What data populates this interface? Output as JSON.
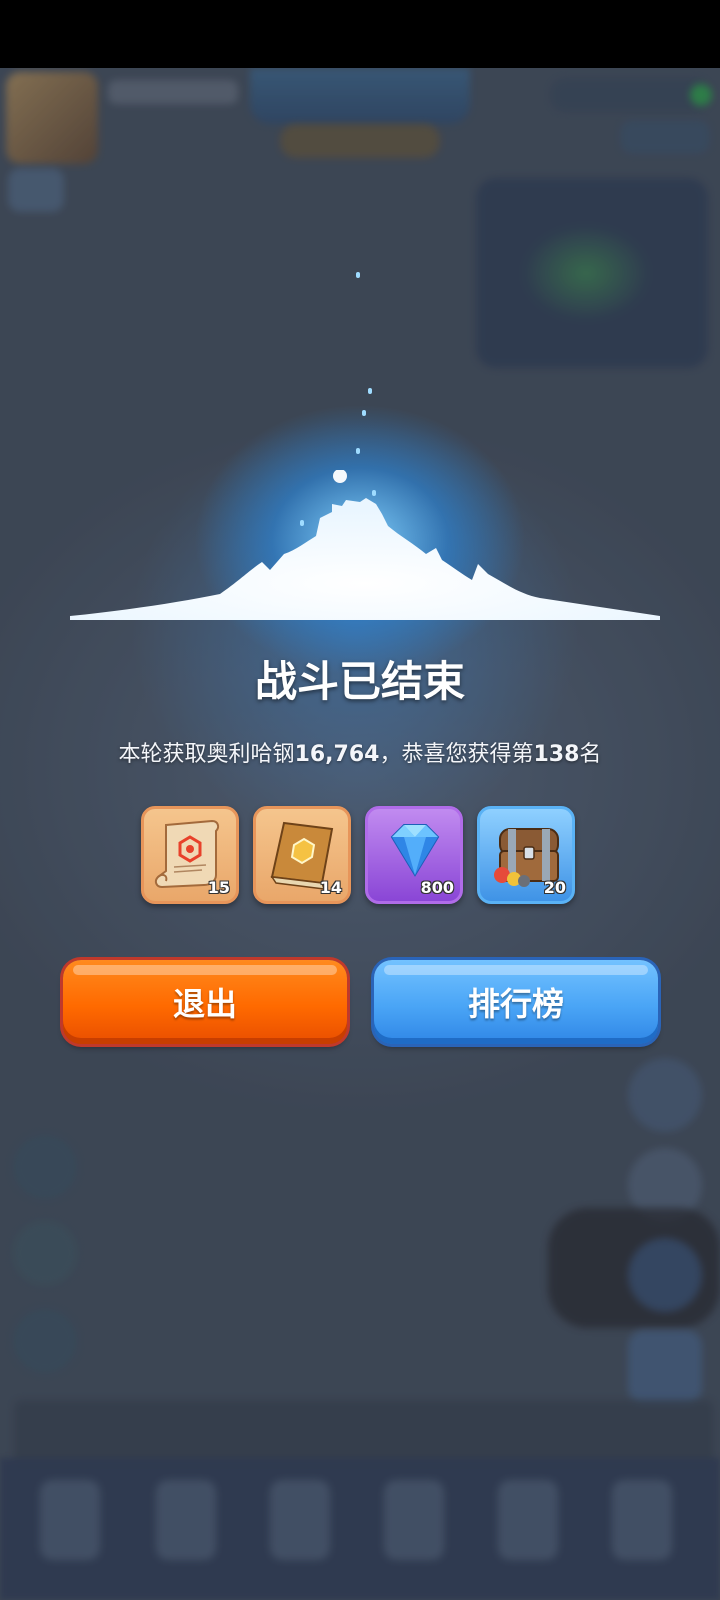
{
  "dialog": {
    "title": "战斗已结束",
    "result_prefix": "本轮获取奥利哈钢",
    "amount": "16,764",
    "result_middle": "，恭喜您获得第",
    "rank": "138",
    "result_suffix": "名"
  },
  "rewards": [
    {
      "icon": "scroll-icon",
      "count": "15",
      "color": "#e9a76a"
    },
    {
      "icon": "book-icon",
      "count": "14",
      "color": "#e9a76a"
    },
    {
      "icon": "diamond-icon",
      "count": "800",
      "color": "#8a46d6"
    },
    {
      "icon": "treasure-chest-icon",
      "count": "20",
      "color": "#3f93e6"
    }
  ],
  "buttons": {
    "exit_label": "退出",
    "leaderboard_label": "排行榜"
  },
  "colors": {
    "exit_button": "#ff6a00",
    "leaderboard_button": "#4aa5f6",
    "glow": "#5ab2f5"
  }
}
